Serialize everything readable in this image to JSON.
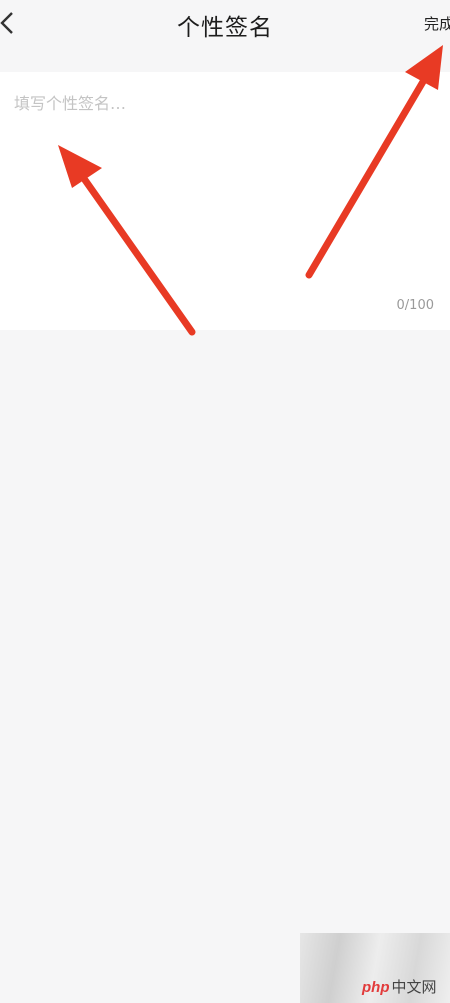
{
  "header": {
    "title": "个性签名",
    "done_label": "完成",
    "back_icon": "chevron-left-icon"
  },
  "editor": {
    "placeholder": "填写个性签名…",
    "value": "",
    "counter": "0/100"
  },
  "annotation": {
    "arrow_color": "#e83a24"
  },
  "watermark": {
    "brand": "php",
    "suffix": "中文网"
  }
}
